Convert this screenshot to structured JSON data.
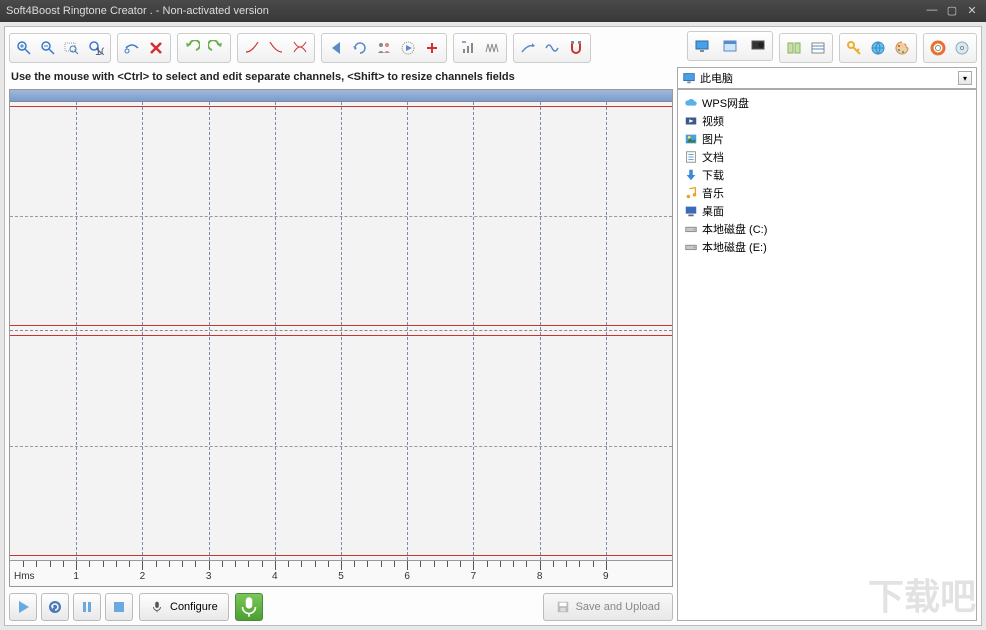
{
  "window": {
    "title": "Soft4Boost Ringtone Creator . - Non-activated version"
  },
  "hint": "Use the mouse with <Ctrl> to select and edit separate channels, <Shift> to resize channels fields",
  "timeline": {
    "unit_label": "Hms",
    "ticks": [
      "1",
      "2",
      "3",
      "4",
      "5",
      "6",
      "7",
      "8",
      "9"
    ]
  },
  "transport": {
    "configure_label": "Configure",
    "save_label": "Save and Upload"
  },
  "browser": {
    "combo_label": "此电脑",
    "items": [
      {
        "icon": "cloud",
        "label": "WPS网盘"
      },
      {
        "icon": "video",
        "label": "视频"
      },
      {
        "icon": "image",
        "label": "图片"
      },
      {
        "icon": "doc",
        "label": "文档"
      },
      {
        "icon": "download",
        "label": "下载"
      },
      {
        "icon": "music",
        "label": "音乐"
      },
      {
        "icon": "desktop",
        "label": "桌面"
      },
      {
        "icon": "drive",
        "label": "本地磁盘 (C:)"
      },
      {
        "icon": "drive",
        "label": "本地磁盘 (E:)"
      }
    ]
  },
  "watermark": "下载吧"
}
